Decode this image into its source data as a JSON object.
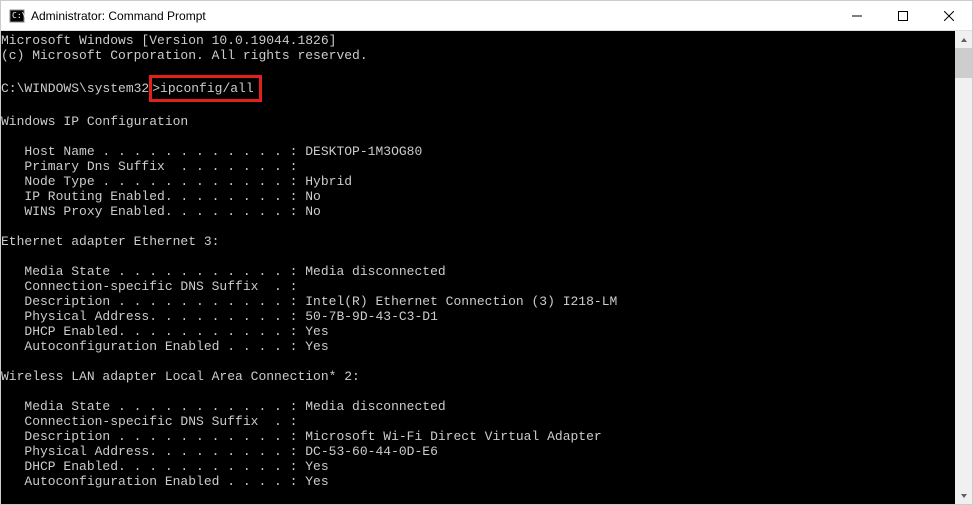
{
  "titlebar": {
    "title": "Administrator: Command Prompt"
  },
  "terminal": {
    "line_version": "Microsoft Windows [Version 10.0.19044.1826]",
    "line_copyright": "(c) Microsoft Corporation. All rights reserved.",
    "prompt_path": "C:\\WINDOWS\\system32",
    "prompt_command": ">ipconfig/all",
    "section_ipconfig": "Windows IP Configuration",
    "host_name_line": "   Host Name . . . . . . . . . . . . : DESKTOP-1M3OG80",
    "primary_dns_line": "   Primary Dns Suffix  . . . . . . . :",
    "node_type_line": "   Node Type . . . . . . . . . . . . : Hybrid",
    "ip_routing_line": "   IP Routing Enabled. . . . . . . . : No",
    "wins_proxy_line": "   WINS Proxy Enabled. . . . . . . . : No",
    "section_eth3": "Ethernet adapter Ethernet 3:",
    "eth3_media_state": "   Media State . . . . . . . . . . . : Media disconnected",
    "eth3_conn_suffix": "   Connection-specific DNS Suffix  . :",
    "eth3_description": "   Description . . . . . . . . . . . : Intel(R) Ethernet Connection (3) I218-LM",
    "eth3_physical": "   Physical Address. . . . . . . . . : 50-7B-9D-43-C3-D1",
    "eth3_dhcp": "   DHCP Enabled. . . . . . . . . . . : Yes",
    "eth3_autoconfig": "   Autoconfiguration Enabled . . . . : Yes",
    "section_wlan2": "Wireless LAN adapter Local Area Connection* 2:",
    "wlan2_media_state": "   Media State . . . . . . . . . . . : Media disconnected",
    "wlan2_conn_suffix": "   Connection-specific DNS Suffix  . :",
    "wlan2_description": "   Description . . . . . . . . . . . : Microsoft Wi-Fi Direct Virtual Adapter",
    "wlan2_physical": "   Physical Address. . . . . . . . . : DC-53-60-44-0D-E6",
    "wlan2_dhcp": "   DHCP Enabled. . . . . . . . . . . : Yes",
    "wlan2_autoconfig": "   Autoconfiguration Enabled . . . . : Yes"
  }
}
